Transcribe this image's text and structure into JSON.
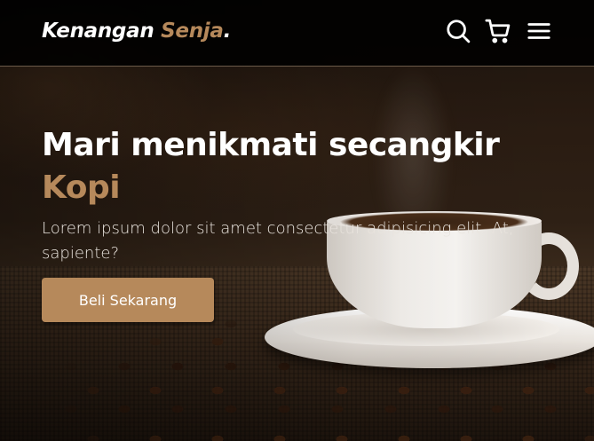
{
  "brand": {
    "name": "Kenangan",
    "accent": "Senja",
    "dot": "."
  },
  "nav": {
    "icons": [
      "search-icon",
      "cart-icon",
      "menu-icon"
    ]
  },
  "hero": {
    "title_line": "Mari menikmati secangkir",
    "title_accent": "Kopi",
    "description": "Lorem ipsum dolor sit amet consectetur adipisicing elit. At, sapiente?",
    "cta_label": "Beli Sekarang"
  },
  "colors": {
    "accent": "#b6895b",
    "navbar": "#000000",
    "text": "#ffffff"
  }
}
